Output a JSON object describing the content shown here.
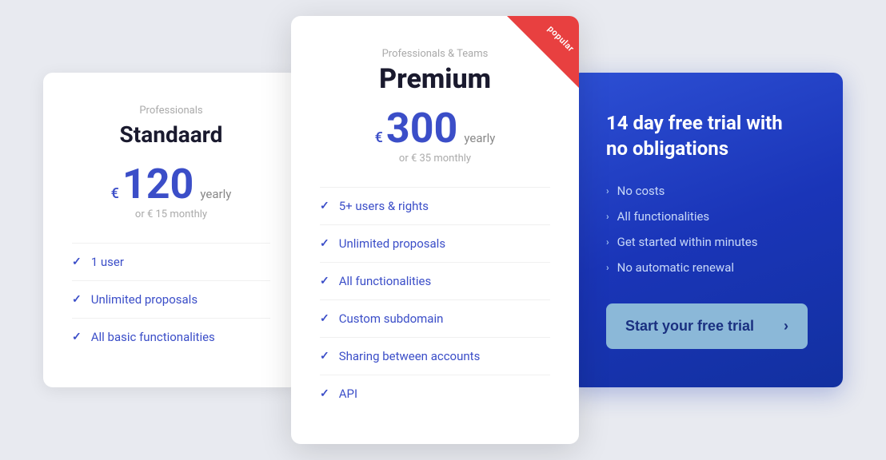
{
  "standard": {
    "subtitle": "Professionals",
    "title": "Standaard",
    "price": "120",
    "currency": "€",
    "period": "yearly",
    "monthly_alt": "or &euro; 15 monthly",
    "features": [
      "1 user",
      "Unlimited proposals",
      "All basic functionalities"
    ]
  },
  "premium": {
    "subtitle": "Professionals & Teams",
    "title": "Premium",
    "popular_label": "popular",
    "price": "300",
    "currency": "€",
    "period": "yearly",
    "monthly_alt": "or &euro; 35 monthly",
    "features": [
      "5+ users & rights",
      "Unlimited proposals",
      "All functionalities",
      "Custom subdomain",
      "Sharing between accounts",
      "API"
    ]
  },
  "trial": {
    "title": "14 day free trial with no obligations",
    "features": [
      "No costs",
      "All functionalities",
      "Get started within minutes",
      "No automatic renewal"
    ],
    "button_label": "Start your free trial",
    "button_arrow": "›"
  }
}
